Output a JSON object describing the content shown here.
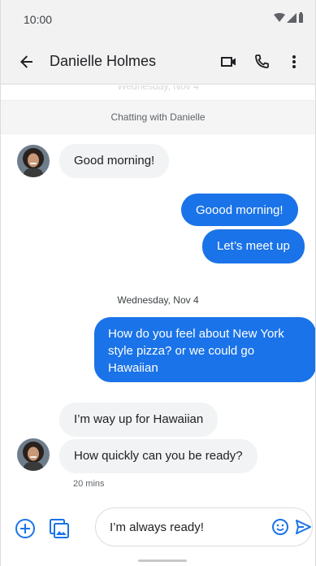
{
  "status_bar": {
    "time": "10:00",
    "icons": [
      "wifi-icon",
      "signal-icon",
      "battery-icon"
    ]
  },
  "app_bar": {
    "back_icon": "arrow-back-icon",
    "title": "Danielle Holmes",
    "actions": [
      "video-call-icon",
      "phone-call-icon",
      "more-vert-icon"
    ]
  },
  "chat": {
    "faded_date": "Wednesday, Nov 4",
    "banner": "Chatting with Danielle",
    "messages": [
      {
        "direction": "incoming",
        "text": "Good morning!"
      },
      {
        "direction": "outgoing",
        "text": "Goood morning!"
      },
      {
        "direction": "outgoing",
        "text": "Let’s meet up"
      },
      {
        "direction": "outgoing",
        "text": "How do you feel about New York style pizza? or we could go Hawaiian"
      },
      {
        "direction": "incoming",
        "text": "I’m way up for Hawaiian"
      },
      {
        "direction": "incoming",
        "text": "How quickly can you be ready?"
      }
    ],
    "date_separator": "Wednesday, Nov 4",
    "last_timestamp": "20 mins"
  },
  "compose": {
    "add_icon": "add-circle-icon",
    "gallery_icon": "gallery-icon",
    "input_value": "I’m always ready!",
    "emoji_icon": "emoji-icon",
    "send_icon": "send-icon"
  },
  "colors": {
    "accent": "#1a73e8",
    "incoming_bubble": "#f1f3f4",
    "bar_background": "#f2f2f2"
  }
}
